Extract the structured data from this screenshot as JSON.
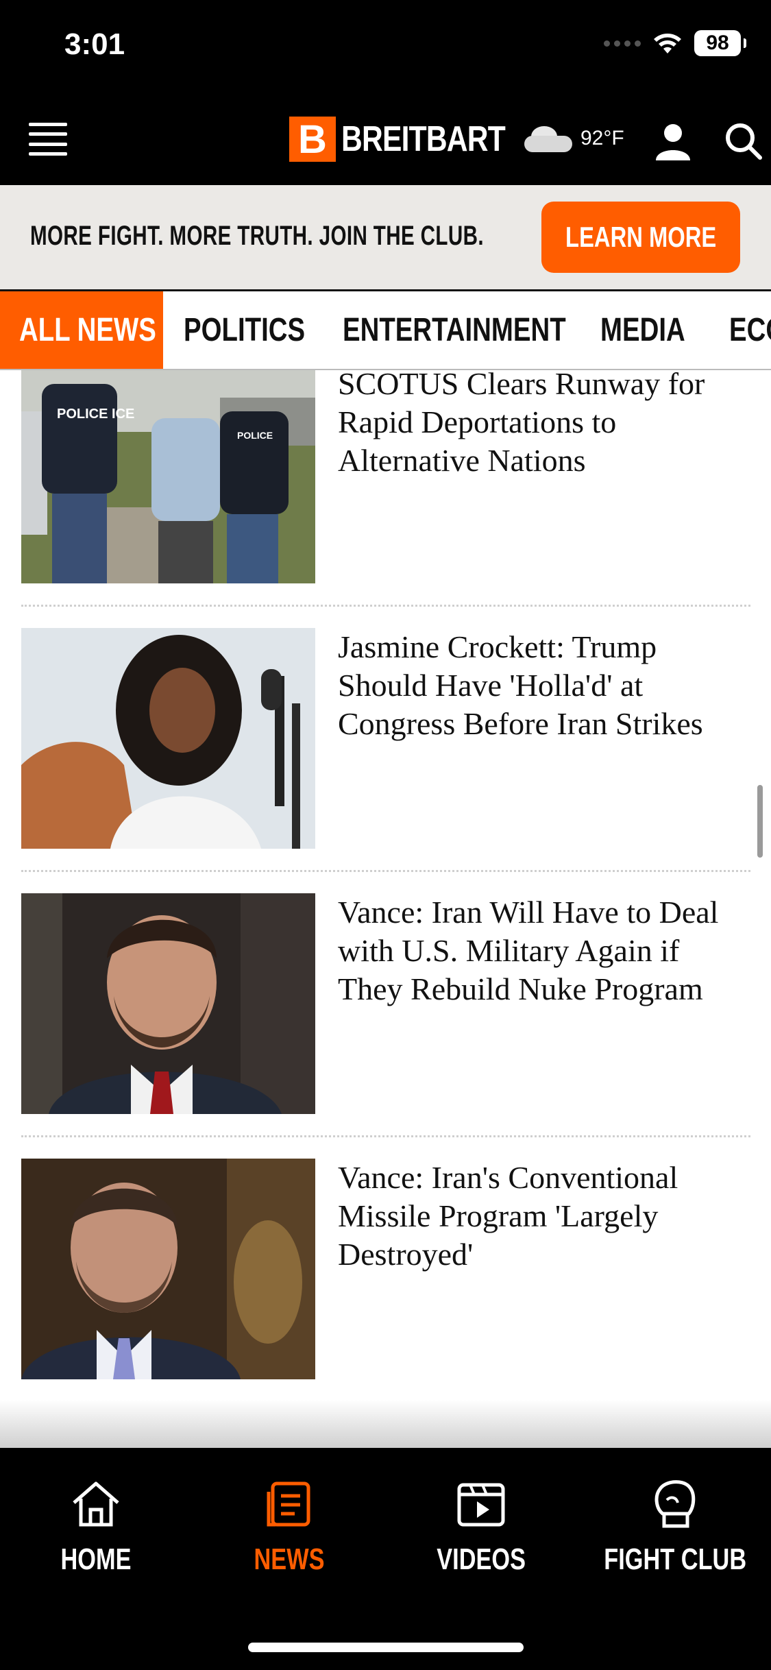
{
  "status_bar": {
    "time": "3:01",
    "battery": "98"
  },
  "header": {
    "logo_letter": "B",
    "logo_text": "BREITBART",
    "temperature": "92°F"
  },
  "promo": {
    "text": "MORE FIGHT. MORE TRUTH. JOIN THE CLUB.",
    "button_label": "LEARN MORE"
  },
  "tabs": [
    {
      "label": "ALL NEWS",
      "active": true
    },
    {
      "label": "POLITICS"
    },
    {
      "label": "ENTERTAINMENT"
    },
    {
      "label": "MEDIA"
    },
    {
      "label": "ECO"
    }
  ],
  "articles": [
    {
      "headline": "SCOTUS Clears Runway for Rapid Deportations to Alternative Nations",
      "image_text_1": "POLICE ICE",
      "image_text_2": "POLICE"
    },
    {
      "headline": "Jasmine Crockett: Trump Should Have 'Holla'd' at Congress Before Iran Strikes"
    },
    {
      "headline": "Vance: Iran Will Have to Deal with U.S. Military Again if They Rebuild Nuke Program"
    },
    {
      "headline": "Vance: Iran's Conventional Missile Program 'Largely Destroyed'"
    }
  ],
  "bottom_nav": [
    {
      "label": "HOME",
      "icon": "home-icon"
    },
    {
      "label": "NEWS",
      "icon": "news-icon",
      "active": true
    },
    {
      "label": "VIDEOS",
      "icon": "videos-icon"
    },
    {
      "label": "FIGHT CLUB",
      "icon": "boxing-glove-icon"
    }
  ],
  "colors": {
    "accent": "#ff5d00",
    "background": "#000000",
    "banner": "#ebe9e6"
  }
}
